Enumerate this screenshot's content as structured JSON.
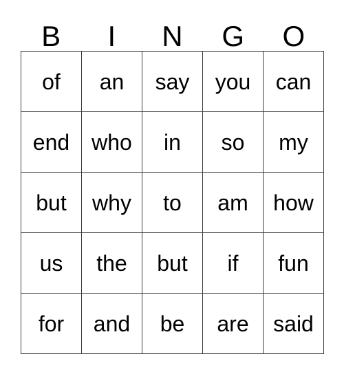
{
  "card": {
    "title": "BINGO",
    "columns": 5,
    "rows": 5,
    "header": [
      "B",
      "I",
      "N",
      "G",
      "O"
    ],
    "grid": [
      [
        "of",
        "an",
        "say",
        "you",
        "can"
      ],
      [
        "end",
        "who",
        "in",
        "so",
        "my"
      ],
      [
        "but",
        "why",
        "to",
        "am",
        "how"
      ],
      [
        "us",
        "the",
        "but",
        "if",
        "fun"
      ],
      [
        "for",
        "and",
        "be",
        "are",
        "said"
      ]
    ],
    "colors": {
      "background": "#ffffff",
      "text": "#000000",
      "border": "#3a3a3a"
    }
  }
}
